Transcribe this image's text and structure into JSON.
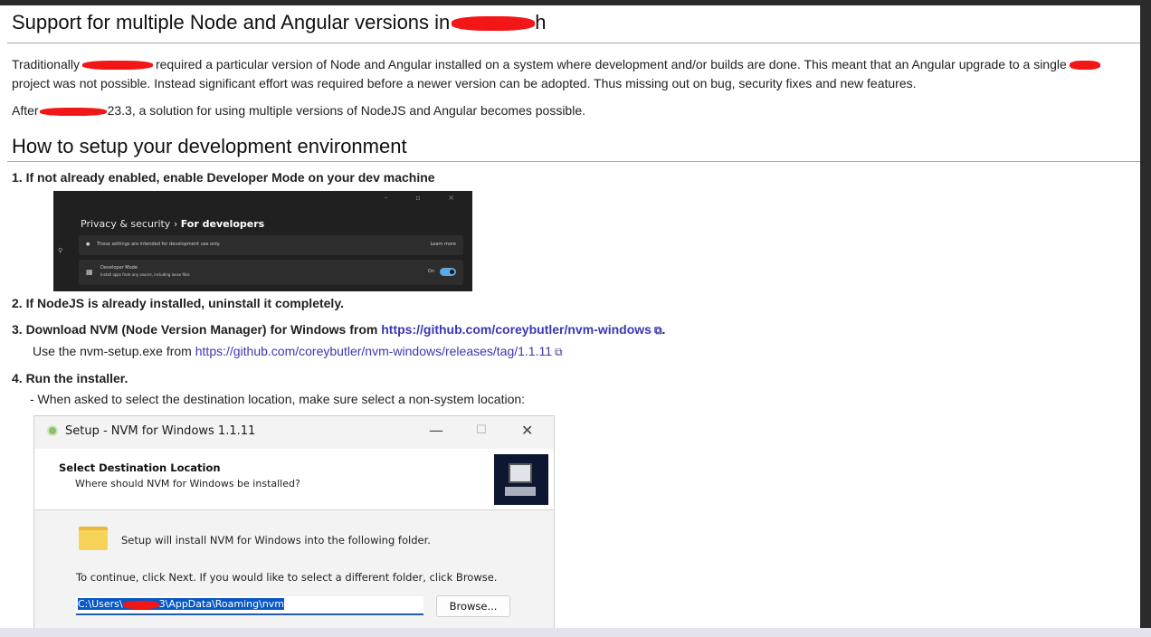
{
  "doc": {
    "title": "Support for multiple Node and Angular versions in",
    "title_tail": "h",
    "intro": {
      "line1_a": "Traditionally",
      "line1_b": "required a particular version of Node and Angular installed on a system where development and/or builds are done. This meant that an Angular upgrade to a single",
      "line2": "project was not possible. Instead significant effort was required before a newer version can be adopted. Thus missing out on bug, security fixes and new features.",
      "after_a": "After",
      "after_b": "23.3, a solution for using multiple versions of NodeJS and Angular becomes possible."
    },
    "setup_heading": "How to setup your development environment",
    "steps": {
      "s1": "1. If not already enabled, enable Developer Mode on your dev machine",
      "s2": "2. If NodeJS is already installed, uninstall it completely.",
      "s3_text": "3. Download NVM (Node Version Manager) for Windows from",
      "s3_link": "https://github.com/coreybutler/nvm-windows",
      "s3_end": ".",
      "s3_note_text": "Use the nvm-setup.exe from",
      "s3_note_link": "https://github.com/coreybutler/nvm-windows/releases/tag/1.1.11",
      "s4": "4. Run the installer.",
      "s4_note": "- When asked to select the destination location, make sure select a non-system location:"
    }
  },
  "dev_settings": {
    "breadcrumb_parent": "Privacy & security",
    "breadcrumb_sep": "›",
    "breadcrumb_current": "For developers",
    "info_text": "These settings are intended for development use only.",
    "learn_more": "Learn more",
    "dev_mode_title": "Developer Mode",
    "dev_mode_desc": "Install apps from any source, including loose files",
    "toggle_state": "On"
  },
  "nvm_dialog": {
    "title": "Setup - NVM for Windows 1.1.11",
    "header_title": "Select Destination Location",
    "header_sub": "Where should NVM for Windows be installed?",
    "install_line": "Setup will install NVM for Windows into the following folder.",
    "continue_line": "To continue, click Next. If you would like to select a different folder, click Browse.",
    "path_a": "C:\\Users\\",
    "path_b": "3\\AppData\\Roaming\\nvm",
    "browse_label": "Browse..."
  },
  "colors": {
    "link": "#3a37b3",
    "redaction": "#f21616",
    "selection": "#0a58c6"
  }
}
